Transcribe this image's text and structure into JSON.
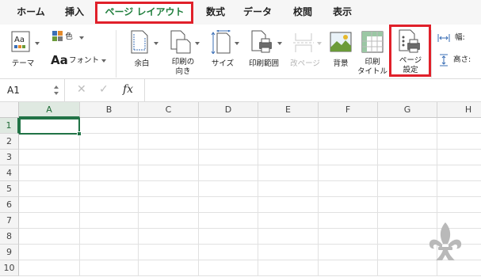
{
  "tabs": [
    {
      "label": "ホーム"
    },
    {
      "label": "挿入"
    },
    {
      "label": "ページ レイアウト",
      "active": true
    },
    {
      "label": "数式"
    },
    {
      "label": "データ"
    },
    {
      "label": "校閲"
    },
    {
      "label": "表示"
    }
  ],
  "ribbon": {
    "theme_label": "テーマ",
    "color_label": "色",
    "font_label": "フォント",
    "font_glyph": "Aa",
    "theme_glyph": "Aa",
    "margins_label": "余白",
    "orientation_label_1": "印刷の",
    "orientation_label_2": "向き",
    "size_label": "サイズ",
    "print_area_label": "印刷範囲",
    "breaks_label": "改ページ",
    "background_label": "背景",
    "print_titles_label_1": "印刷",
    "print_titles_label_2": "タイトル",
    "page_setup_label_1": "ページ",
    "page_setup_label_2": "設定",
    "width_label": "幅:",
    "height_label": "高さ:"
  },
  "formula_bar": {
    "name_box": "A1",
    "fx": "fx",
    "cancel_glyph": "✕",
    "enter_glyph": "✓",
    "formula": ""
  },
  "grid": {
    "columns": [
      "A",
      "B",
      "C",
      "D",
      "E",
      "F",
      "G",
      "H"
    ],
    "rows": [
      "1",
      "2",
      "3",
      "4",
      "5",
      "6",
      "7",
      "8",
      "9",
      "10"
    ],
    "selected_cell": "A1"
  },
  "colors": {
    "accent": "#217346",
    "highlight": "#e0202a"
  }
}
